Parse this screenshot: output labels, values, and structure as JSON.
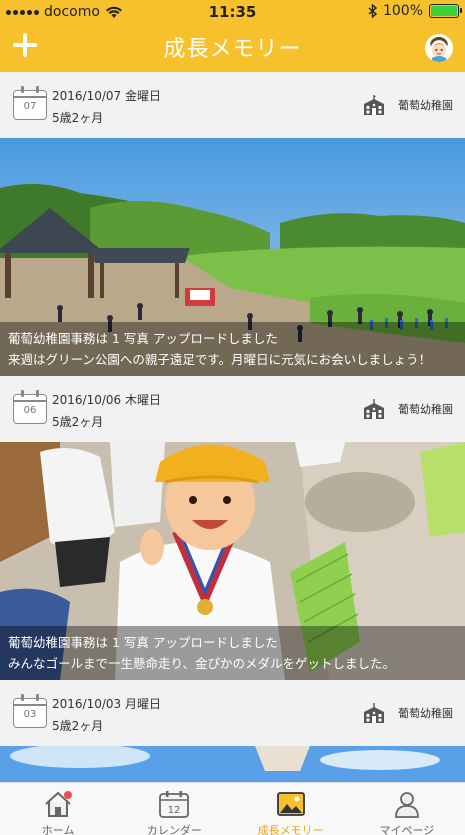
{
  "status_bar": {
    "carrier": "docomo",
    "time": "11:35",
    "battery": "100%"
  },
  "header": {
    "title": "成長メモリー"
  },
  "colors": {
    "accent": "#f7c12d",
    "active_tab": "#e8a90e"
  },
  "posts": [
    {
      "cal_day": "07",
      "date": "2016/10/07 金曜日",
      "age": "5歳2ヶ月",
      "school": "葡萄幼稚園",
      "caption_line1": "葡萄幼稚園事務は 1 写真 アップロードしました",
      "caption_line2": "来週はグリーン公園への親子遠足です。月曜日に元気にお会いしましょう！"
    },
    {
      "cal_day": "06",
      "date": "2016/10/06 木曜日",
      "age": "5歳2ヶ月",
      "school": "葡萄幼稚園",
      "caption_line1": "葡萄幼稚園事務は 1 写真 アップロードしました",
      "caption_line2": "みんなゴールまで一生懸命走り、金ぴかのメダルをゲットしました。"
    },
    {
      "cal_day": "03",
      "date": "2016/10/03 月曜日",
      "age": "5歳2ヶ月",
      "school": "葡萄幼稚園"
    }
  ],
  "tabs": [
    {
      "label": "ホーム",
      "icon": "home-icon"
    },
    {
      "label": "カレンダー",
      "icon": "calendar-icon",
      "day": "12"
    },
    {
      "label": "成長メモリー",
      "icon": "photo-album-icon",
      "active": true
    },
    {
      "label": "マイページ",
      "icon": "person-icon"
    }
  ]
}
